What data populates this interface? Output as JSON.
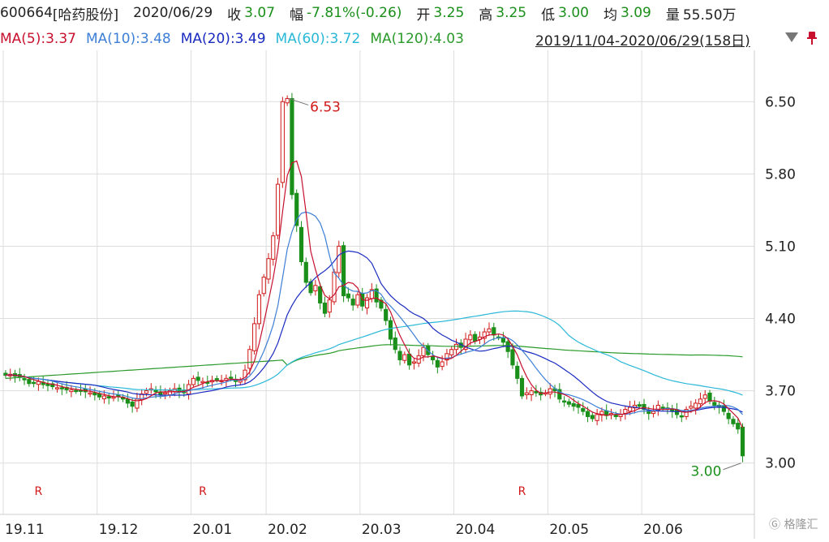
{
  "header": {
    "code": "600664",
    "name": "[哈药股份]",
    "date": "2020/06/29",
    "close_label": "收",
    "close": "3.07",
    "change_label": "幅",
    "change": "-7.81%(-0.26)",
    "open_label": "开",
    "open": "3.25",
    "high_label": "高",
    "high": "3.25",
    "low_label": "低",
    "low": "3.00",
    "avg_label": "均",
    "avg": "3.09",
    "vol_label": "量",
    "vol": "55.50万"
  },
  "ma_bar": {
    "ma5": "MA(5):3.37",
    "ma10": "MA(10):3.48",
    "ma20": "MA(20):3.49",
    "ma60": "MA(60):3.72",
    "ma120": "MA(120):4.03",
    "range": "2019/11/04-2020/06/29(158日)"
  },
  "colors": {
    "up": "#d01818",
    "down": "#1a8f1a",
    "ma5": "#c8102e",
    "ma10": "#3d7fd6",
    "ma20": "#1a2bc0",
    "ma60": "#2ab8d8",
    "ma120": "#2a9a2a",
    "grid": "#dddddd"
  },
  "watermark": "格隆汇",
  "chart_data": {
    "type": "candlestick",
    "y_ticks": [
      "6.50",
      "5.80",
      "5.10",
      "4.40",
      "3.70",
      "3.00"
    ],
    "ylim": [
      2.55,
      6.95
    ],
    "x_ticks": [
      "19.11",
      "19.12",
      "20.01",
      "20.02",
      "20.03",
      "20.04",
      "20.05",
      "20.06"
    ],
    "x_tick_index": [
      0,
      20,
      40,
      56,
      76,
      96,
      116,
      136
    ],
    "total_days": 158,
    "max_label": "6.53",
    "min_label": "3.00",
    "r_marks": [
      7,
      42,
      110
    ],
    "r_text": "R",
    "close": [
      3.85,
      3.86,
      3.84,
      3.83,
      3.81,
      3.77,
      3.78,
      3.79,
      3.76,
      3.75,
      3.74,
      3.73,
      3.72,
      3.71,
      3.71,
      3.7,
      3.7,
      3.69,
      3.68,
      3.66,
      3.64,
      3.65,
      3.63,
      3.64,
      3.65,
      3.62,
      3.58,
      3.55,
      3.62,
      3.67,
      3.7,
      3.72,
      3.69,
      3.66,
      3.68,
      3.7,
      3.72,
      3.69,
      3.68,
      3.76,
      3.82,
      3.8,
      3.79,
      3.78,
      3.8,
      3.81,
      3.8,
      3.82,
      3.83,
      3.79,
      3.8,
      3.9,
      4.1,
      4.35,
      4.63,
      4.8,
      4.98,
      5.2,
      5.7,
      6.5,
      6.53,
      5.6,
      5.3,
      4.95,
      4.75,
      4.65,
      4.72,
      4.55,
      4.45,
      4.58,
      4.85,
      5.1,
      4.62,
      4.6,
      4.53,
      4.63,
      4.52,
      4.6,
      4.68,
      4.56,
      4.5,
      4.38,
      4.2,
      4.1,
      4.0,
      4.05,
      3.95,
      3.98,
      4.04,
      4.12,
      4.05,
      4.0,
      3.93,
      3.98,
      4.06,
      4.1,
      4.15,
      4.12,
      4.2,
      4.24,
      4.18,
      4.22,
      4.27,
      4.3,
      4.24,
      4.22,
      4.17,
      4.08,
      3.95,
      3.82,
      3.65,
      3.68,
      3.7,
      3.68,
      3.66,
      3.68,
      3.72,
      3.7,
      3.62,
      3.6,
      3.57,
      3.55,
      3.54,
      3.5,
      3.45,
      3.43,
      3.47,
      3.5,
      3.46,
      3.48,
      3.45,
      3.47,
      3.52,
      3.54,
      3.56,
      3.55,
      3.52,
      3.48,
      3.5,
      3.56,
      3.54,
      3.52,
      3.5,
      3.47,
      3.45,
      3.52,
      3.55,
      3.58,
      3.62,
      3.66,
      3.6,
      3.56,
      3.54,
      3.5,
      3.43,
      3.38,
      3.33,
      3.07
    ]
  }
}
